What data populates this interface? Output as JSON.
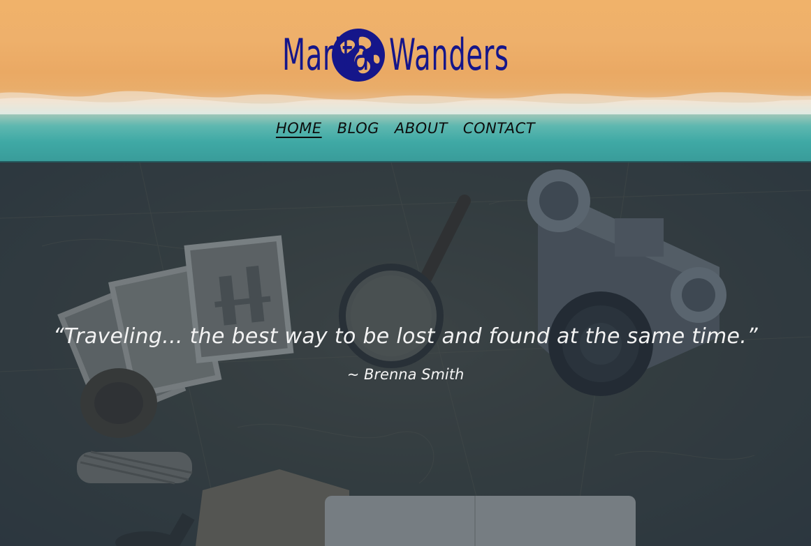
{
  "brand": {
    "word_left": "Marita",
    "word_right": "Wanders",
    "logo_icon": "globe-icon",
    "color": "#15168a"
  },
  "nav": {
    "items": [
      {
        "label": "HOME",
        "active": true
      },
      {
        "label": "BLOG",
        "active": false
      },
      {
        "label": "ABOUT",
        "active": false
      },
      {
        "label": "CONTACT",
        "active": false
      }
    ]
  },
  "hero": {
    "quote": "“Traveling... the best way to be lost and found at the same time.”",
    "author": "~ Brenna Smith"
  }
}
